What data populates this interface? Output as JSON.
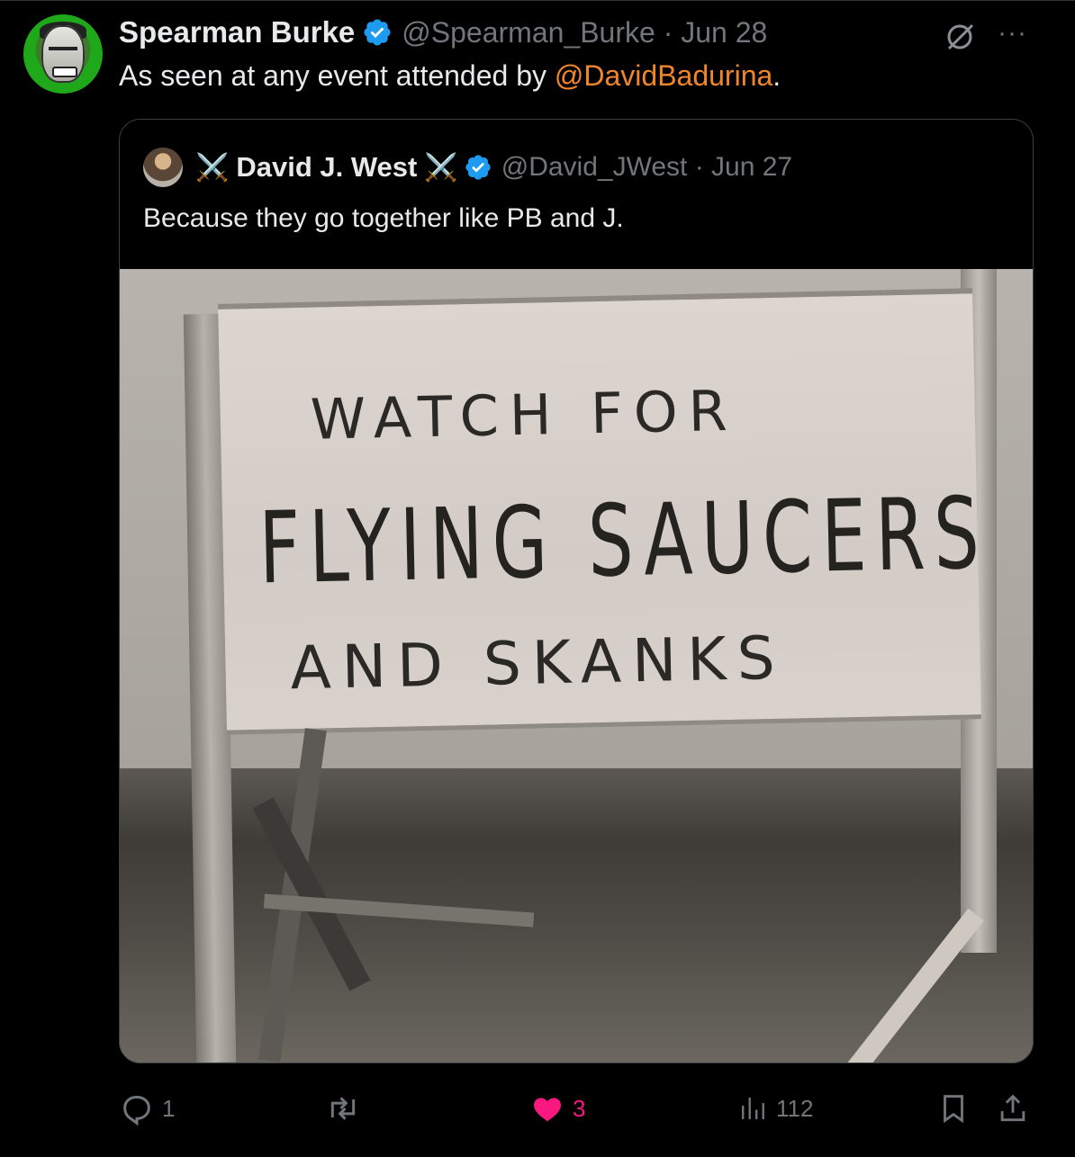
{
  "tweet": {
    "author_name": "Spearman Burke",
    "author_handle": "@Spearman_Burke",
    "date": "Jun 28",
    "handle_date": "@Spearman_Burke · Jun 28",
    "text_before": "As seen at any event attended by ",
    "mention": "@DavidBadurina",
    "text_after": ".",
    "more_label": "···"
  },
  "quoted": {
    "swords": "⚔️",
    "author_name": "David J. West",
    "handle_date": "@David_JWest · Jun 27",
    "text": "Because they go together like PB and J."
  },
  "photo": {
    "sign_line1": "WATCH FOR",
    "sign_line2": "FLYING SAUCERS",
    "sign_line3": "AND SKANKS"
  },
  "actions": {
    "replies": "1",
    "reposts": "",
    "likes": "3",
    "views": "112"
  },
  "colors": {
    "background": "#000000",
    "text": "#e7e9ea",
    "muted": "#71767b",
    "mention": "#f0862a",
    "verified": "#1d9bf0",
    "like": "#f91880"
  }
}
